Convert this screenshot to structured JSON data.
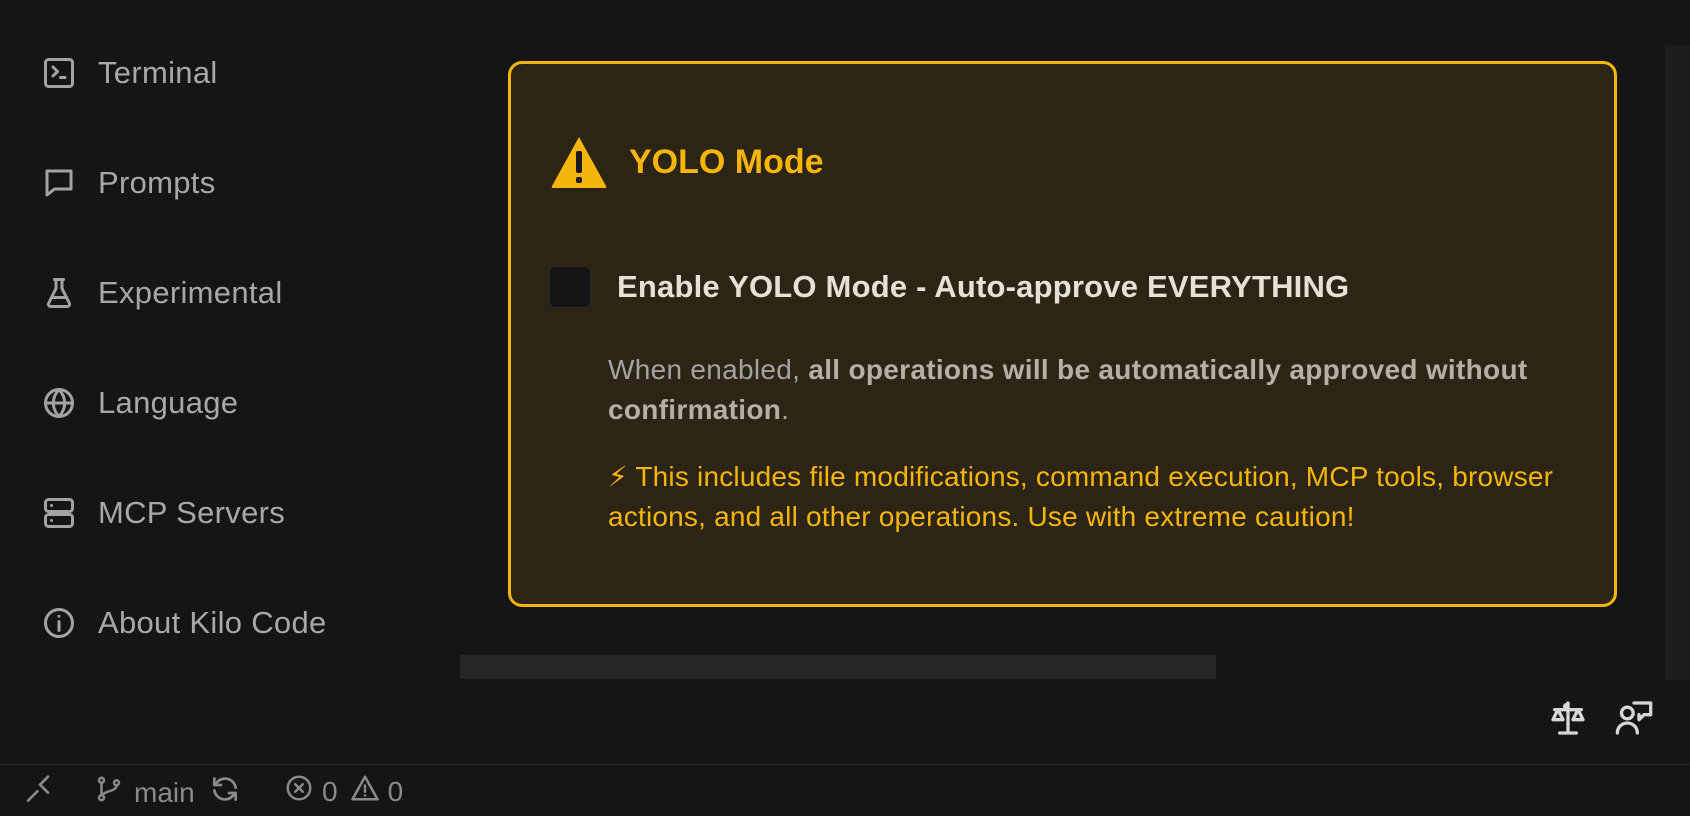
{
  "sidebar": {
    "items": [
      {
        "label": "Terminal",
        "icon": "terminal-icon"
      },
      {
        "label": "Prompts",
        "icon": "chat-icon"
      },
      {
        "label": "Experimental",
        "icon": "flask-icon"
      },
      {
        "label": "Language",
        "icon": "globe-icon"
      },
      {
        "label": "MCP Servers",
        "icon": "server-icon"
      },
      {
        "label": "About Kilo Code",
        "icon": "info-icon"
      }
    ]
  },
  "yolo": {
    "title": "YOLO Mode",
    "toggle_label": "Enable YOLO Mode - Auto-approve EVERYTHING",
    "checked": false,
    "desc_prefix": "When enabled, ",
    "desc_bold": "all operations will be automatically approved without confirmation",
    "desc_suffix": ".",
    "caution_icon": "⚡",
    "caution": " This includes file modifications, command execution, MCP tools, browser actions, and all other operations. Use with extreme caution!"
  },
  "bottom_icons": [
    "scale-icon",
    "feedback-person-icon"
  ],
  "statusbar": {
    "branch": "main",
    "errors": "0",
    "warnings": "0"
  },
  "colors": {
    "accent": "#f5b50a",
    "card_bg": "#2c2414",
    "background": "#151515"
  }
}
